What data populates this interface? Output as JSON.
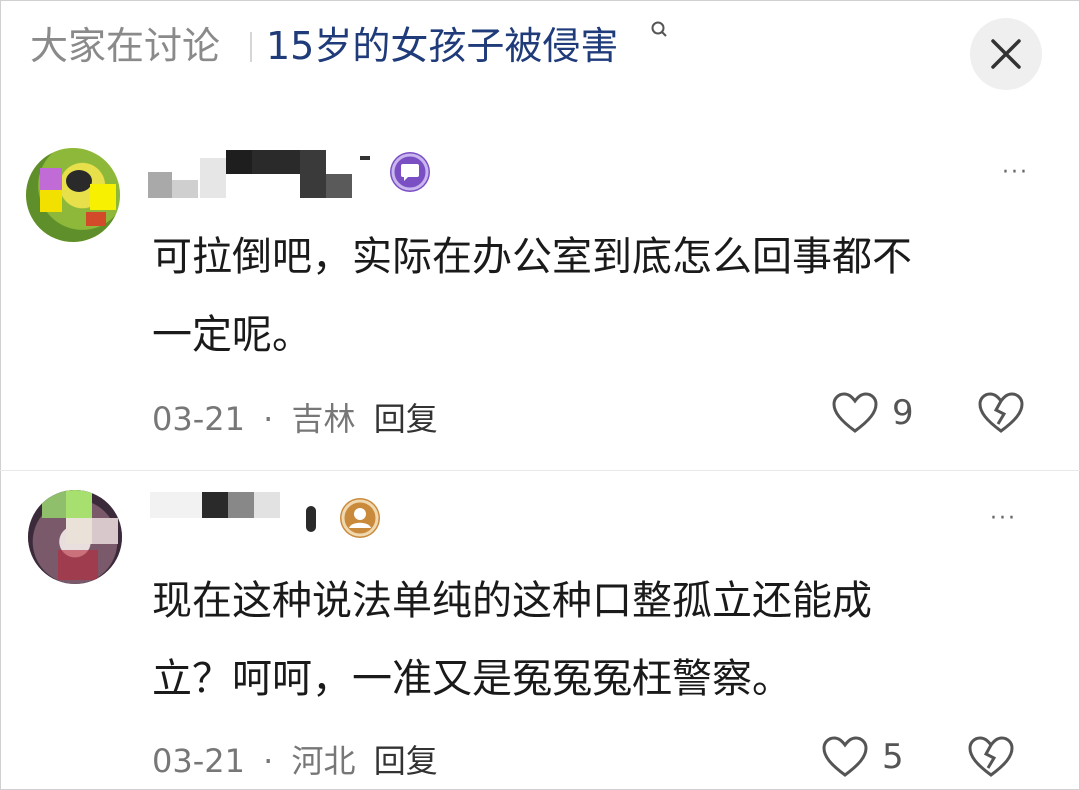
{
  "header": {
    "prefix": "大家在讨论",
    "topic": "15岁的女孩子被侵害",
    "search_icon": "search-icon",
    "close_icon": "close-icon"
  },
  "comments": [
    {
      "text_line1": "可拉倒吧，实际在办公室到底怎么回事都不",
      "text_line2": "一定呢。",
      "date": "03-21",
      "location": "吉林",
      "reply_label": "回复",
      "like_count": "9",
      "badge_icon": "chat-badge-icon",
      "badge_color": "#7b4fc4"
    },
    {
      "text_line1": "现在这种说法单纯的这种口整孤立还能成",
      "text_line2": "立？呵呵，一准又是冤冤冤枉警察。",
      "date": "03-21",
      "location": "河北",
      "reply_label": "回复",
      "like_count": "5",
      "badge_icon": "user-badge-icon",
      "badge_color": "#c98a3c"
    }
  ],
  "separator": "·",
  "more_label": "···"
}
